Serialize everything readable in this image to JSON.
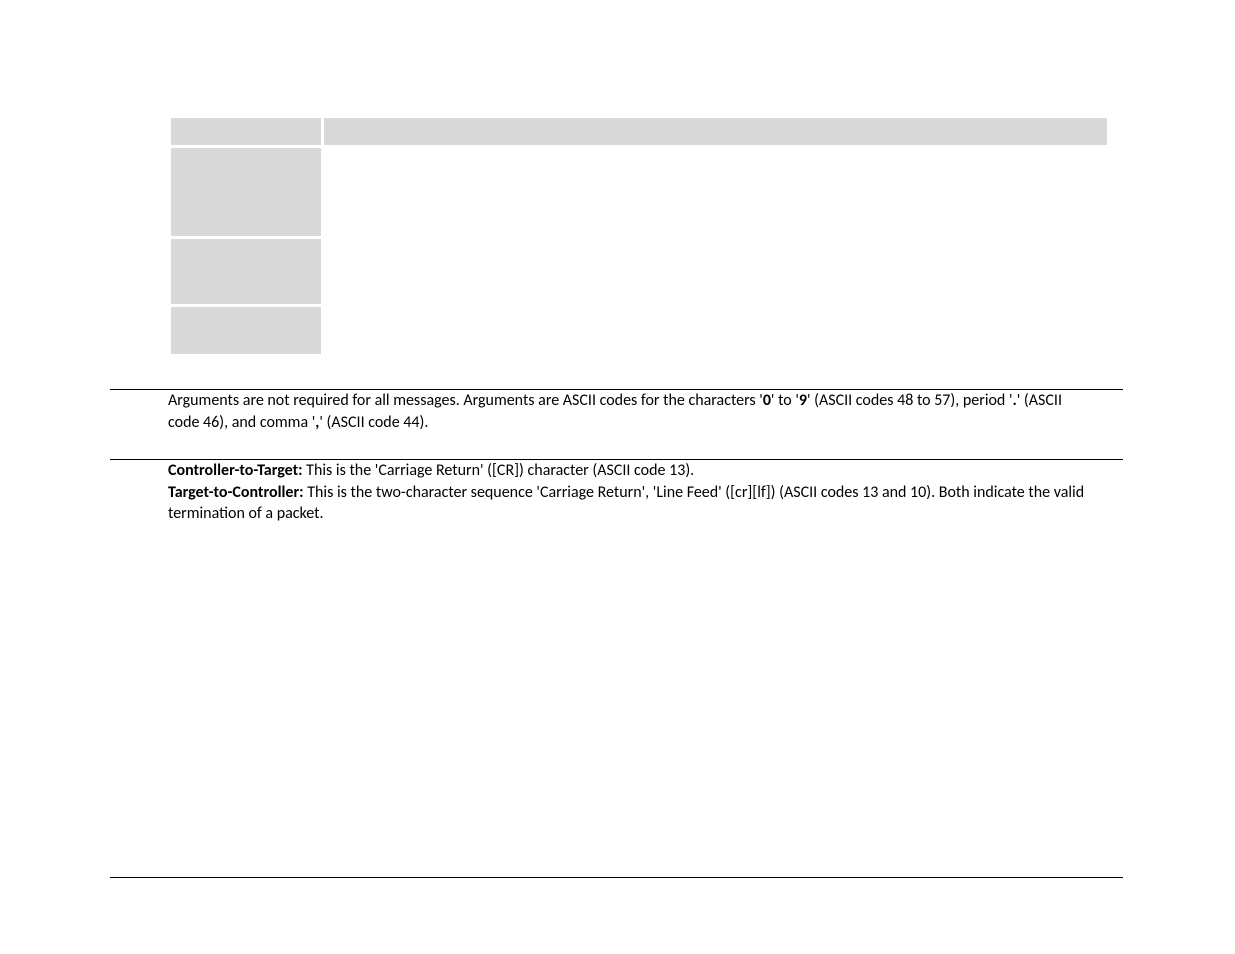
{
  "arguments_paragraph": {
    "pre_0": "Arguments are not required for all messages. Arguments are ASCII codes for the characters '",
    "b_0": "0",
    "mid_0": "' to '",
    "b_9": "9",
    "post_0": "' (ASCII codes 48 to 57), period '",
    "b_period": ".",
    "post_period": "' (ASCII code 46), and comma '",
    "b_comma": ",",
    "post_comma": "' (ASCII code 44)."
  },
  "controller_to_target": {
    "label": "Controller-to-Target:",
    "text": " This is the 'Carriage Return' ([CR]) character (ASCII code 13)."
  },
  "target_to_controller": {
    "label": "Target-to-Controller:",
    "text": " This is the two-character sequence 'Carriage Return', 'Line Feed' ([cr][lf]) (ASCII codes 13 and 10).  Both indicate the valid termination of a packet."
  }
}
